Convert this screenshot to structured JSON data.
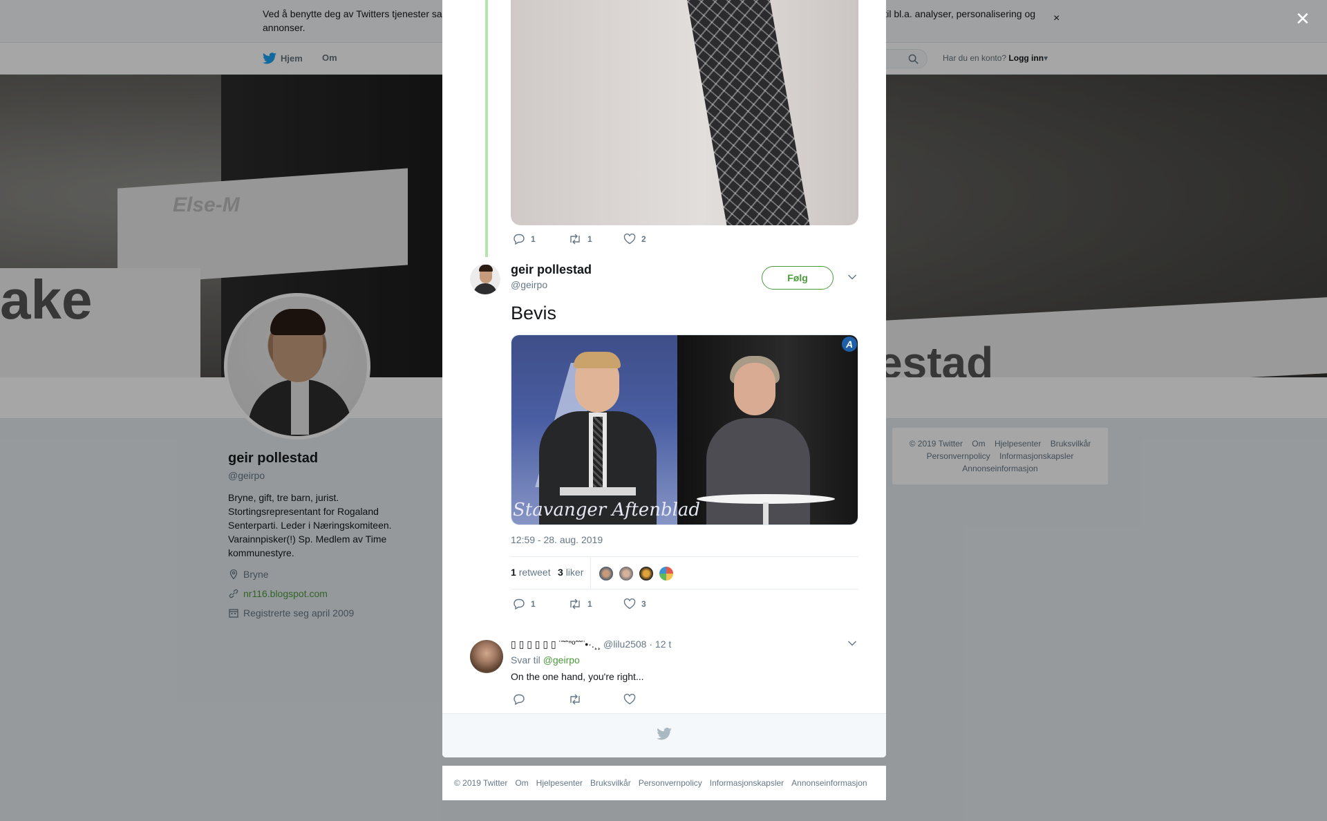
{
  "cookie": {
    "text": "Ved å benytte deg av Twitters tjenester samtykker du i at vi kan bruke informasjonskapsler og lignende teknologier, inkludert informasjonskapsler til bl.a. analyser, personalisering og annonser.",
    "close_glyph": "×"
  },
  "nav": {
    "home": "Hjem",
    "about": "Om",
    "login_prompt": "Har du en konto?",
    "login": "Logg inn"
  },
  "banner": {
    "sign_left": "ake",
    "sign_mid": "Else-M",
    "sign_right": "estad"
  },
  "profile": {
    "name": "geir pollestad",
    "handle": "@geirpo",
    "bio": "Bryne, gift, tre barn, jurist. Stortingsrepresentant for Rogaland Senterparti. Leder i Næringskomiteen. Varainnpisker(!) Sp. Medlem av Time kommunestyre.",
    "location": "Bryne",
    "website": "nr116.blogspot.com",
    "joined": "Registrerte seg april 2009"
  },
  "side_footer": {
    "line1": [
      "© 2019 Twitter",
      "Om",
      "Hjelpesenter",
      "Bruksvilkår"
    ],
    "line2": [
      "Personvernpolicy",
      "Informasjonskapsler"
    ],
    "line3": [
      "Annonseinformasjon"
    ]
  },
  "overlay": {
    "close_glyph": "✕"
  },
  "parent_tweet": {
    "replies": "1",
    "retweets": "1",
    "likes": "2"
  },
  "tweet": {
    "name": "geir pollestad",
    "handle": "@geirpo",
    "follow_label": "Følg",
    "text": "Bevis",
    "video_caption": "Stavanger Aftenblad",
    "video_badge": "A",
    "timestamp": "12:59 - 28. aug. 2019",
    "retweet_count": "1",
    "retweet_label": "retweet",
    "like_count": "3",
    "like_label": "liker",
    "replies": "1",
    "retweets": "1",
    "likes": "3"
  },
  "reply": {
    "name": "▯ ▯ ▯ ▯ ▯ ▯ ¨˜ˆ”ºˆ˜¨•·.¸¸",
    "handle": "@lilu2508",
    "time": "· 12 t",
    "reply_to_prefix": "Svar til",
    "reply_to_handle": "@geirpo",
    "text": "On the one hand, you're right..."
  },
  "bottom_footer": {
    "items": [
      "© 2019 Twitter",
      "Om",
      "Hjelpesenter",
      "Bruksvilkår",
      "Personvernpolicy",
      "Informasjonskapsler",
      "Annonseinformasjon"
    ]
  },
  "colors": {
    "accent": "#4a9a3a",
    "thread_line": "#b9e0b0",
    "muted": "#657786"
  }
}
